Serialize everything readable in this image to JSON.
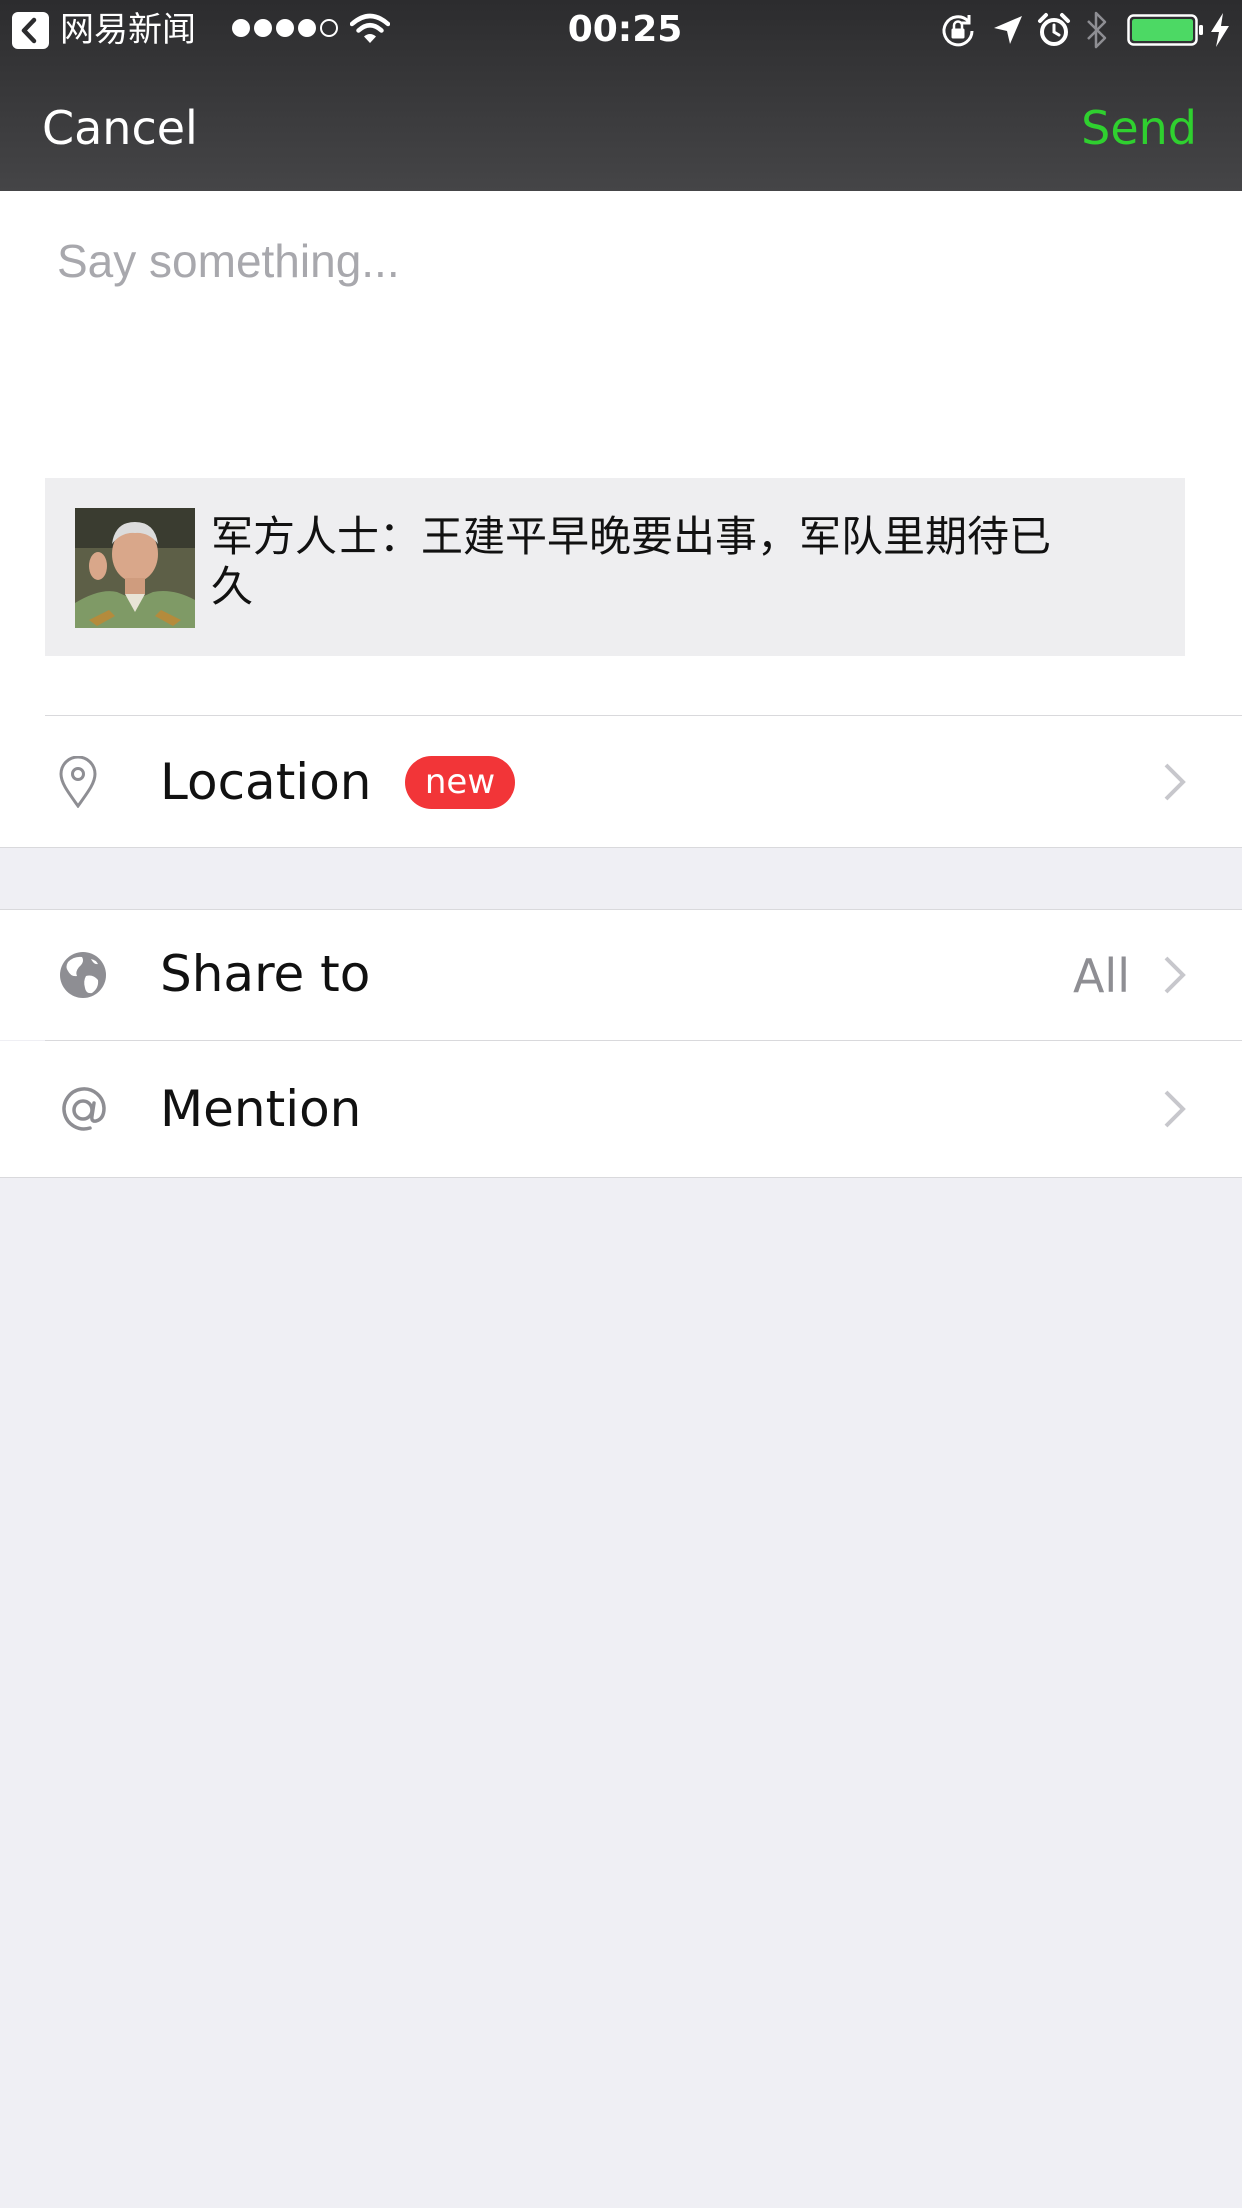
{
  "status_bar": {
    "back_app": "网易新闻",
    "signal_filled": 4,
    "signal_total": 5,
    "time": "00:25",
    "battery_level": 1.0,
    "icons": [
      "back-icon",
      "wifi-icon",
      "rotation-lock-icon",
      "location-arrow-icon",
      "alarm-icon",
      "bluetooth-icon",
      "battery-icon",
      "charging-icon"
    ]
  },
  "nav": {
    "cancel_label": "Cancel",
    "send_label": "Send",
    "send_color": "#2fd02f"
  },
  "compose": {
    "placeholder": "Say something...",
    "value": ""
  },
  "article": {
    "title": "军方人士：王建平早晚要出事，军队里期待已久",
    "thumbnail": "man-in-uniform-photo"
  },
  "rows": {
    "location": {
      "label": "Location",
      "badge": "new",
      "badge_color": "#f23538",
      "icon": "location-pin-icon"
    },
    "share": {
      "label": "Share to",
      "value": "All",
      "icon": "globe-icon"
    },
    "mention": {
      "label": "Mention",
      "icon": "at-icon"
    }
  },
  "colors": {
    "topbar": "#2c2c2e",
    "background": "#efeff4",
    "accent": "#2fd02f"
  }
}
